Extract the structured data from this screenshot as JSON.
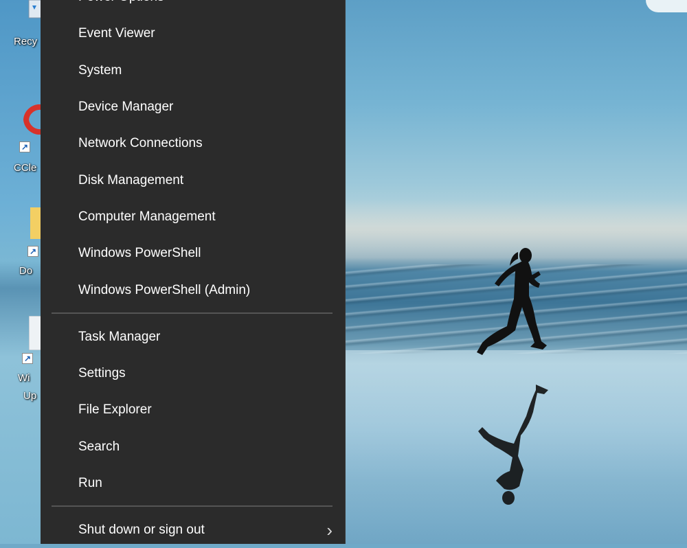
{
  "desktop": {
    "icons": [
      {
        "label": "Recy",
        "icon": "recycle-bin-icon"
      },
      {
        "label": "CCle",
        "icon": "ccleaner-icon"
      },
      {
        "label": "Do",
        "icon": "folder-icon"
      },
      {
        "label": "Wi",
        "label2": "Up",
        "icon": "windows-update-icon"
      }
    ]
  },
  "menu": {
    "group1": [
      {
        "label": "Power Options"
      },
      {
        "label": "Event Viewer"
      },
      {
        "label": "System"
      },
      {
        "label": "Device Manager"
      },
      {
        "label": "Network Connections"
      },
      {
        "label": "Disk Management"
      },
      {
        "label": "Computer Management"
      },
      {
        "label": "Windows PowerShell"
      },
      {
        "label": "Windows PowerShell (Admin)"
      }
    ],
    "group2": [
      {
        "label": "Task Manager"
      },
      {
        "label": "Settings"
      },
      {
        "label": "File Explorer"
      },
      {
        "label": "Search"
      },
      {
        "label": "Run"
      }
    ],
    "group3": [
      {
        "label": "Shut down or sign out",
        "submenu_icon": "chevron-right-icon"
      }
    ]
  },
  "colors": {
    "menu_bg": "#2b2b2b",
    "menu_text": "#ffffff",
    "separator": "#555555"
  }
}
